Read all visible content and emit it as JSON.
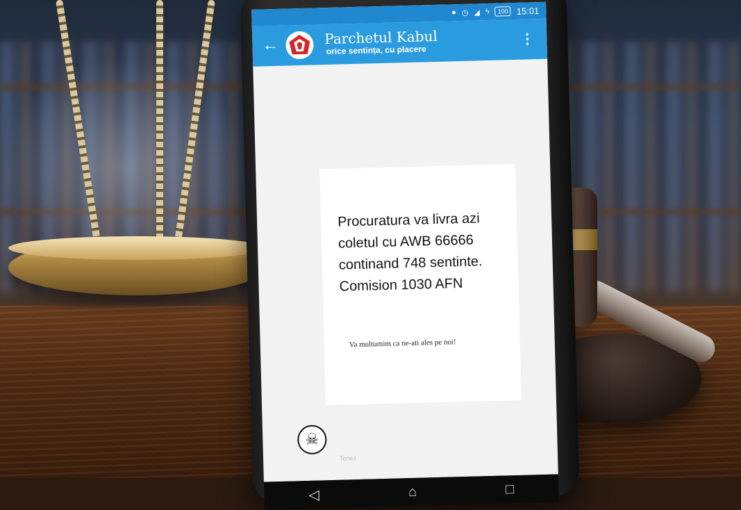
{
  "status_bar": {
    "icons": [
      "location-icon",
      "alarm-icon",
      "signal-icon",
      "charging-icon"
    ],
    "battery": "100",
    "time": "15:01"
  },
  "app_bar": {
    "title": "Parchetul Kabul",
    "subtitle": "orice sentința, cu placere",
    "accent_color": "#2b9be0"
  },
  "message": {
    "body": "Procuratura va livra azi coletul cu AWB 66666 continand 748 sentinte. Comision 1030 AFN",
    "footer": "Va multumim ca ne-ati ales pe noi!"
  },
  "compose": {
    "placeholder": "Tenez",
    "attach_icon": "skull-crossbones-icon"
  },
  "nav_bar": {
    "icons": [
      "back-triangle-icon",
      "home-icon",
      "recents-icon"
    ]
  }
}
